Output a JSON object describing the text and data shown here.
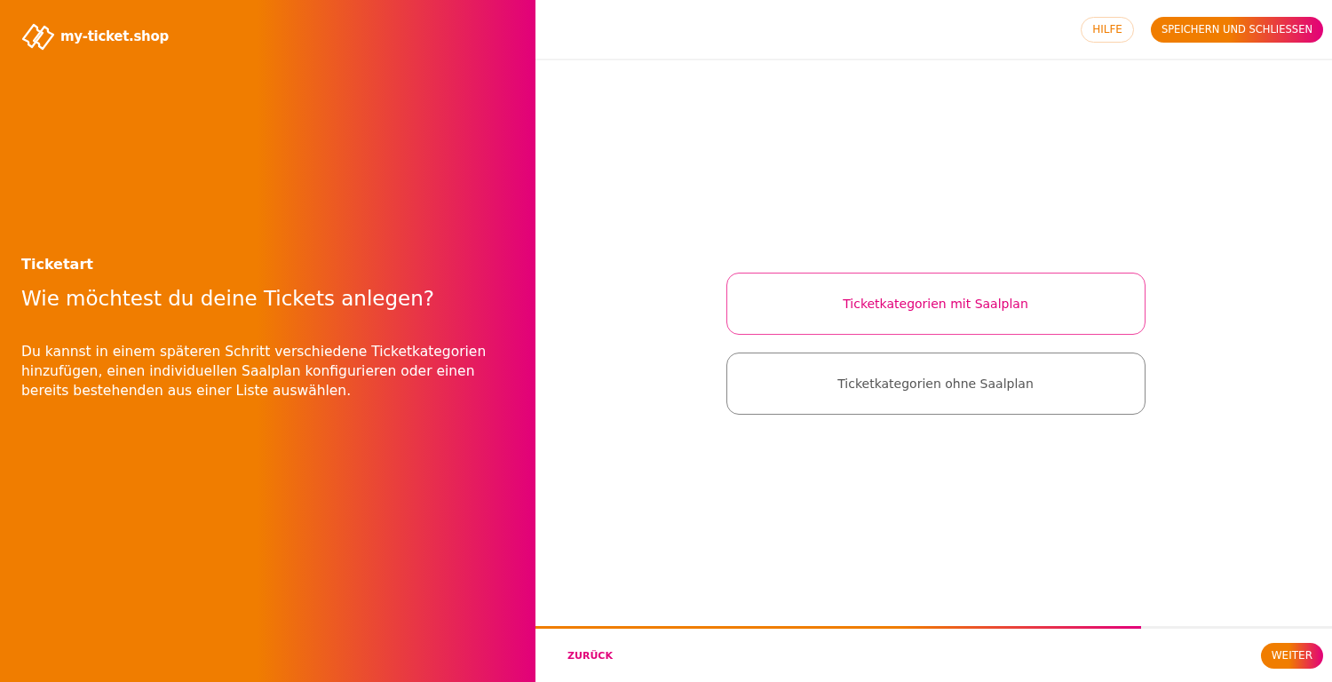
{
  "brand": {
    "name": "my-ticket.shop"
  },
  "intro": {
    "step": "Ticketart",
    "question": "Wie möchtest du deine Tickets anlegen?",
    "description": "Du kannst in einem späteren Schritt verschiedene Ticketkategorien hinzufügen, einen individuellen Saalplan konfigurieren oder einen bereits bestehenden aus einer Liste auswählen."
  },
  "header": {
    "help": "HILFE",
    "save": "SPEICHERN UND SCHLIESSEN"
  },
  "options": [
    {
      "label": "Ticketkategorien mit Saalplan",
      "selected": true
    },
    {
      "label": "Ticketkategorien ohne Saalplan",
      "selected": false
    }
  ],
  "progress": {
    "level": 0.76
  },
  "footer": {
    "back": "ZURÜCK",
    "next": "WEITER"
  }
}
